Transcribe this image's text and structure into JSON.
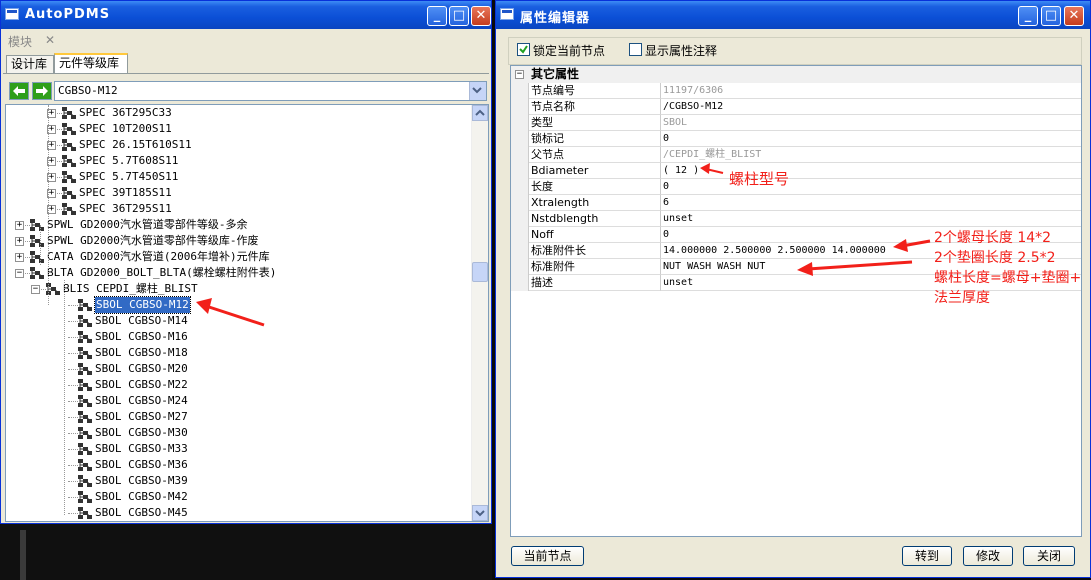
{
  "left_window": {
    "title": "AutoPDMS",
    "menu": {
      "module": "模块",
      "close": "✕"
    },
    "tabs": [
      "设计库",
      "元件等级库"
    ],
    "combo_value": "CGBSO-M12",
    "tree_nodes": [
      {
        "label": "SPEC 36T295C33"
      },
      {
        "label": "SPEC 10T200S11"
      },
      {
        "label": "SPEC 26.15T610S11"
      },
      {
        "label": "SPEC 5.7T608S11"
      },
      {
        "label": "SPEC 5.7T450S11"
      },
      {
        "label": "SPEC 39T185S11"
      },
      {
        "label": "SPEC 36T295S11"
      },
      {
        "label": "SPWL GD2000汽水管道零部件等级-多余"
      },
      {
        "label": "SPWL GD2000汽水管道零部件等级库-作废"
      },
      {
        "label": "CATA GD2000汽水管道(2006年增补)元件库"
      },
      {
        "label": "BLTA GD2000_BOLT_BLTA(螺栓螺柱附件表)"
      },
      {
        "label": "BLIS CEPDI_螺柱_BLIST"
      },
      {
        "label": "SBOL CGBSO-M12"
      },
      {
        "label": "SBOL CGBSO-M14"
      },
      {
        "label": "SBOL CGBSO-M16"
      },
      {
        "label": "SBOL CGBSO-M18"
      },
      {
        "label": "SBOL CGBSO-M20"
      },
      {
        "label": "SBOL CGBSO-M22"
      },
      {
        "label": "SBOL CGBSO-M24"
      },
      {
        "label": "SBOL CGBSO-M27"
      },
      {
        "label": "SBOL CGBSO-M30"
      },
      {
        "label": "SBOL CGBSO-M33"
      },
      {
        "label": "SBOL CGBSO-M36"
      },
      {
        "label": "SBOL CGBSO-M39"
      },
      {
        "label": "SBOL CGBSO-M42"
      },
      {
        "label": "SBOL CGBSO-M45"
      }
    ]
  },
  "right_window": {
    "title": "属性编辑器",
    "lock_label": "锁定当前节点",
    "lock_checked": true,
    "show_comment_label": "显示属性注释",
    "group_header": "其它属性",
    "properties": [
      {
        "key": "节点编号",
        "value": "11197/6306"
      },
      {
        "key": "节点名称",
        "value": "/CGBSO-M12"
      },
      {
        "key": "类型",
        "value": "SBOL"
      },
      {
        "key": "锁标记",
        "value": "0"
      },
      {
        "key": "父节点",
        "value": "/CEPDI_螺柱_BLIST"
      },
      {
        "key": "Bdiameter",
        "value": "( 12 )"
      },
      {
        "key": "长度",
        "value": "0"
      },
      {
        "key": "Xtralength",
        "value": "6"
      },
      {
        "key": "Nstdblength",
        "value": "unset"
      },
      {
        "key": "Noff",
        "value": "0"
      },
      {
        "key": "标准附件长",
        "value": "14.000000 2.500000 2.500000 14.000000"
      },
      {
        "key": "标准附件",
        "value": "NUT WASH WASH NUT"
      },
      {
        "key": "描述",
        "value": "unset"
      }
    ],
    "buttons": {
      "current": "当前节点",
      "goto": "转到",
      "modify": "修改",
      "close": "关闭"
    }
  },
  "annotations": {
    "bolt_type": "螺柱型号",
    "nut_length": "2个螺母长度 14*2",
    "washer_length": "2个垫圈长度 2.5*2",
    "bolt_formula_1": "螺柱长度=螺母+垫圈+",
    "bolt_formula_2": "法兰厚度"
  },
  "colors": {
    "titlebar": "#0b4fd6",
    "selection": "#316ac5",
    "annotation": "#f2201a"
  }
}
